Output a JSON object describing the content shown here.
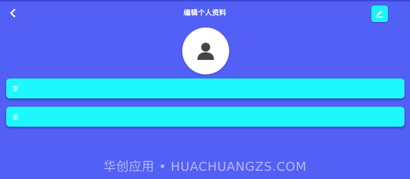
{
  "header": {
    "title": "编辑个人资料",
    "back_icon": "chevron-left-icon",
    "edit_icon": "pencil-icon"
  },
  "profile": {
    "avatar_icon": "user-silhouette-icon"
  },
  "form": {
    "first_name_value": "李",
    "last_name_value": "雷"
  },
  "watermark": {
    "text": "华创应用 • HUACHUANGZS.COM"
  },
  "colors": {
    "background": "#5360f5",
    "field": "#1ef8fd",
    "edit_button": "#1ef2f7",
    "avatar_bg": "#ffffff",
    "avatar_icon": "#444444"
  }
}
